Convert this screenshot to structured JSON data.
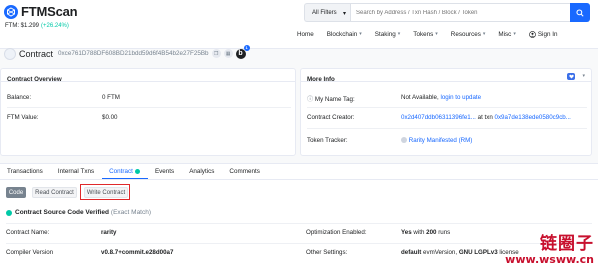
{
  "brand": {
    "name": "FTMScan"
  },
  "price": {
    "label": "FTM: $1.299",
    "change": "(+26.24%)"
  },
  "search": {
    "filter": "All Filters",
    "placeholder": "Search by Address / Txn Hash / Block / Token"
  },
  "nav": {
    "items": [
      "Home",
      "Blockchain",
      "Staking",
      "Tokens",
      "Resources",
      "Misc"
    ],
    "signin": "Sign In"
  },
  "contract": {
    "title": "Contract",
    "address": "0xce761D788DF608BD21bdd59d6f4B54b2e27F25Bb",
    "badge": "b",
    "badge_count": "1"
  },
  "overview": {
    "title": "Contract Overview",
    "balance_label": "Balance:",
    "balance_value": "0 FTM",
    "value_label": "FTM Value:",
    "value_value": "$0.00"
  },
  "moreinfo": {
    "title": "More Info",
    "nametag_label": "My Name Tag:",
    "nametag_value": "Not Available,",
    "nametag_link": "login to update",
    "creator_label": "Contract Creator:",
    "creator_addr": "0x2d407ddb06311396fe1...",
    "creator_at": "at txn",
    "creator_txn": "0x9a7de138ede0580c9cb...",
    "tracker_label": "Token Tracker:",
    "tracker_value": "Rarity Manifested (RM)"
  },
  "tabs": {
    "items": [
      "Transactions",
      "Internal Txns",
      "Contract",
      "Events",
      "Analytics",
      "Comments"
    ],
    "active": "Contract"
  },
  "code_buttons": {
    "code": "Code",
    "read": "Read Contract",
    "write": "Write Contract"
  },
  "verified": {
    "label": "Contract Source Code Verified",
    "exact": "(Exact Match)"
  },
  "details": {
    "name_label": "Contract Name:",
    "name_value": "rarity",
    "optimization_label": "Optimization Enabled:",
    "optimization_yes": "Yes",
    "optimization_with": "with",
    "optimization_runs": "200",
    "optimization_runs_label": "runs",
    "compiler_label": "Compiler Version",
    "compiler_value": "v0.8.7+commit.e28d00a7",
    "other_label": "Other Settings:",
    "other_evm": "default",
    "other_evm_label": "evmVersion,",
    "other_license": "GNU LGPLv3",
    "other_license_label": "license"
  },
  "watermark": {
    "line1": "链圈子",
    "line2": "www.wsww.cn"
  }
}
